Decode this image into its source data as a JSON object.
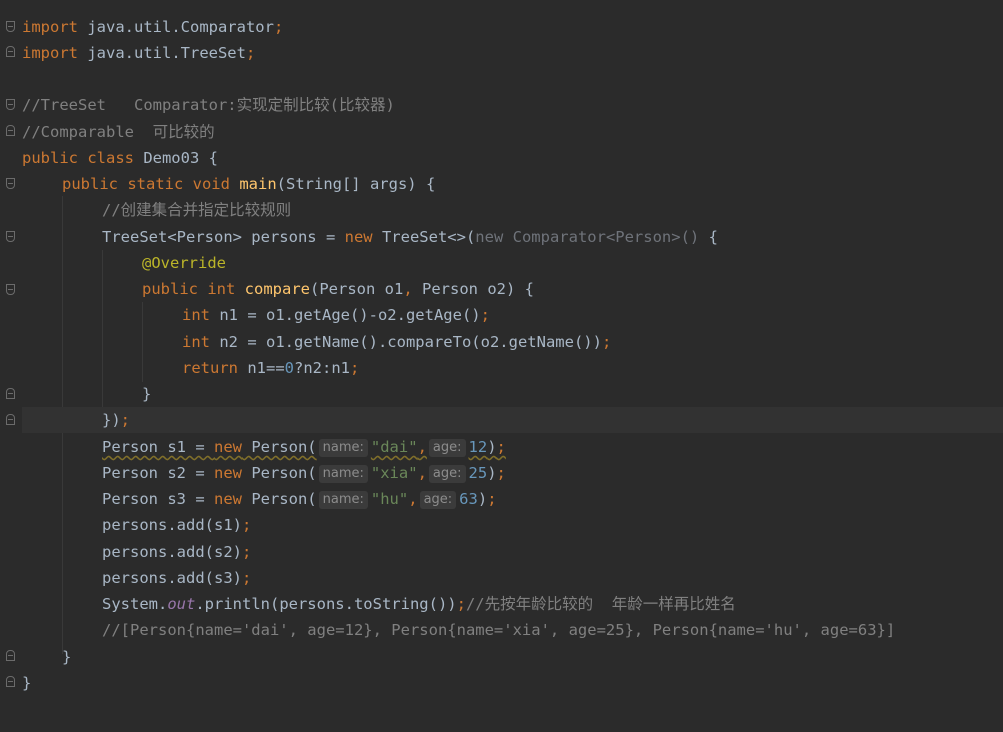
{
  "editor": {
    "colors": {
      "background": "#2b2b2b",
      "keyword": "#cc7832",
      "method": "#ffc66d",
      "comment": "#808080",
      "string": "#6a8759",
      "number": "#6897bb",
      "annotation": "#bbb529",
      "static_field": "#9876aa",
      "text": "#a9b7c6"
    },
    "l1": {
      "kw": "import",
      "rest": " java.util.Comparator",
      "semi": ";"
    },
    "l2": {
      "kw": "import",
      "rest": " java.util.TreeSet",
      "semi": ";"
    },
    "l4": {
      "comment": "//TreeSet   Comparator:实现定制比较(比较器)"
    },
    "l5": {
      "comment": "//Comparable  可比较的"
    },
    "l6": {
      "kw": "public class",
      "rest": " Demo03 {"
    },
    "l7": {
      "kw": "public static void",
      "fn": "main",
      "rest": "(String[] args) {"
    },
    "l8": {
      "comment": "//创建集合并指定比较规则"
    },
    "l9": {
      "a": "TreeSet<Person> persons = ",
      "kw": "new",
      "b": " TreeSet<>(",
      "dim": "new Comparator<Person>()",
      "c": " {"
    },
    "l10": {
      "ann": "@Override"
    },
    "l11": {
      "kw": "public int",
      "fn": "compare",
      "a": "(Person o1",
      "comma1": ",",
      "b": " Person o2) {"
    },
    "l12": {
      "kw": "int",
      "a": " n1 = o1.getAge()-o2.getAge()",
      "semi": ";"
    },
    "l13": {
      "kw": "int",
      "a": " n2 = o1.getName().compareTo(o2.getName())",
      "semi": ";"
    },
    "l14": {
      "kw": "return",
      "a": " n1==",
      "num": "0",
      "b": "?n2:n1",
      "semi": ";"
    },
    "l15": {
      "text": "}"
    },
    "l16": {
      "text": "})",
      "semi": ";"
    },
    "l17": {
      "a": "Person s1 = ",
      "kw": "new",
      "b": " Person(",
      "hint1": "name:",
      "str": "\"dai\"",
      "comma": ",",
      "hint2": "age:",
      "num": "12",
      "c": ")",
      "semi": ";"
    },
    "l18": {
      "a": "Person s2 = ",
      "kw": "new",
      "b": " Person(",
      "hint1": "name:",
      "str": "\"xia\"",
      "comma": ",",
      "hint2": "age:",
      "num": "25",
      "c": ")",
      "semi": ";"
    },
    "l19": {
      "a": "Person s3 = ",
      "kw": "new",
      "b": " Person(",
      "hint1": "name:",
      "str": "\"hu\"",
      "comma": ",",
      "hint2": "age:",
      "num": "63",
      "c": ")",
      "semi": ";"
    },
    "l20": {
      "a": "persons.add(s1)",
      "semi": ";"
    },
    "l21": {
      "a": "persons.add(s2)",
      "semi": ";"
    },
    "l22": {
      "a": "persons.add(s3)",
      "semi": ";"
    },
    "l23": {
      "a": "System.",
      "st": "out",
      "b": ".println(persons.toString())",
      "semi": ";",
      "comment": "//先按年龄比较的  年龄一样再比姓名"
    },
    "l24": {
      "comment": "//[Person{name='dai', age=12}, Person{name='xia', age=25}, Person{name='hu', age=63}]"
    },
    "l25": {
      "text": "}"
    },
    "l26": {
      "text": "}"
    }
  }
}
